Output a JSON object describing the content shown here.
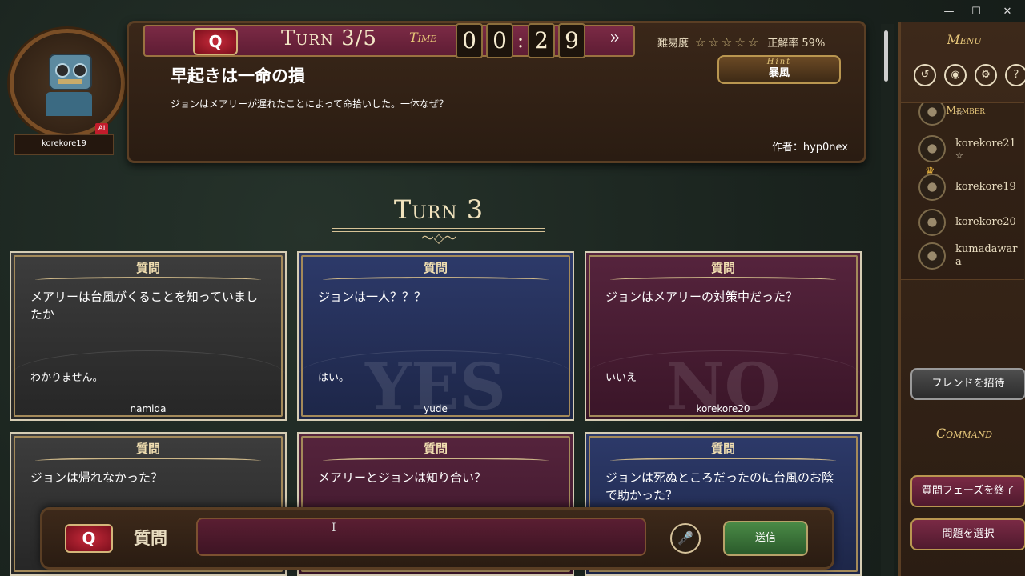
{
  "window": {
    "minimize": "—",
    "maximize": "☐",
    "close": "✕"
  },
  "header": {
    "q_badge": "Q",
    "turn": "Turn 3/5",
    "time_label": "Time",
    "digits": [
      "0",
      "0",
      "2",
      "9"
    ],
    "colon": ":",
    "skip": "»",
    "difficulty_label": "難易度",
    "stars": "☆☆☆☆☆",
    "accuracy": "正解率 59%",
    "hint_label": "Hint",
    "hint_value": "暴風",
    "title": "早起きは一命の損",
    "description": "ジョンはメアリーが遅れたことによって命拾いした。一体なぜ？",
    "author": "作者：hyp0nex"
  },
  "player": {
    "name": "korekore19",
    "ai_badge": "AI"
  },
  "turn_heading": "Turn 3",
  "turn_ornament": "〜◇〜",
  "cards": [
    {
      "caption": "質問",
      "question": "メアリーは台風がくることを知っていましたか",
      "answer": "わかりません。",
      "watermark": "",
      "author": "namida",
      "color": "gray"
    },
    {
      "caption": "質問",
      "question": "ジョンは一人？？？",
      "answer": "はい。",
      "watermark": "YES",
      "author": "yude",
      "color": "blue"
    },
    {
      "caption": "質問",
      "question": "ジョンはメアリーの対策中だった？",
      "answer": "いいえ",
      "watermark": "NO",
      "author": "korekore20",
      "color": "wine"
    },
    {
      "caption": "質問",
      "question": "ジョンは帰れなかった？",
      "answer": "",
      "watermark": "",
      "author": "",
      "color": "gray"
    },
    {
      "caption": "質問",
      "question": "メアリーとジョンは知り合い？",
      "answer": "",
      "watermark": "",
      "author": "",
      "color": "wine"
    },
    {
      "caption": "質問",
      "question": "ジョンは死ぬところだったのに台風のお陰で助かった？",
      "answer": "",
      "watermark": "",
      "author": "",
      "color": "blue"
    }
  ],
  "input": {
    "q_badge": "Q",
    "label": "質問",
    "value": "",
    "placeholder": "",
    "mic": "🎤",
    "send": "送信",
    "cursor": "I"
  },
  "sidebar": {
    "menu": "Menu",
    "icons": [
      {
        "name": "back-icon",
        "glyph": "↺"
      },
      {
        "name": "discord-icon",
        "glyph": "◉"
      },
      {
        "name": "gear-icon",
        "glyph": "⚙"
      },
      {
        "name": "help-icon",
        "glyph": "?"
      }
    ],
    "members_head": "Member",
    "members": [
      {
        "name": "",
        "star": "☆"
      },
      {
        "name": "korekore21",
        "star": "☆"
      },
      {
        "name": "korekore19",
        "star": ""
      },
      {
        "name": "korekore20",
        "star": ""
      },
      {
        "name": "kumadawara",
        "star": ""
      }
    ],
    "crown": "♛",
    "invite": "フレンドを招待",
    "command": "Command",
    "end_phase": "質問フェーズを終了",
    "select_problem": "問題を選択"
  }
}
